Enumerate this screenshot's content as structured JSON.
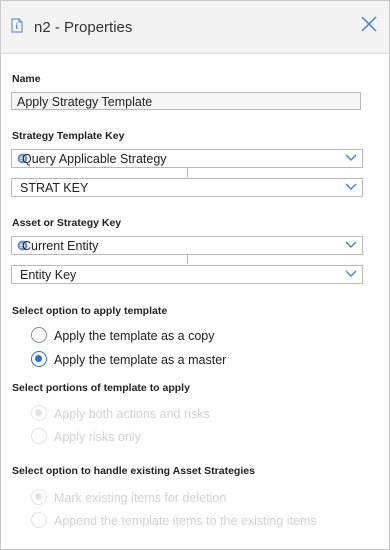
{
  "header": {
    "title": "n2 - Properties",
    "doc_icon": "document-icon",
    "close_icon": "close-icon"
  },
  "name_section": {
    "label": "Name",
    "value": "Apply Strategy Template"
  },
  "strategy_template_key": {
    "label": "Strategy Template Key",
    "source_value": "Query Applicable Strategy",
    "key_value": "STRAT KEY"
  },
  "asset_key": {
    "label": "Asset or Strategy Key",
    "source_value": "Current Entity",
    "key_value": "Entity Key"
  },
  "apply_option": {
    "label": "Select option to apply template",
    "options": [
      {
        "label": "Apply the template as a copy",
        "selected": false
      },
      {
        "label": "Apply the template as a master",
        "selected": true
      }
    ]
  },
  "portions_option": {
    "label": "Select portions of template to apply",
    "disabled": true,
    "options": [
      {
        "label": "Apply both actions and risks",
        "selected": true
      },
      {
        "label": "Apply risks only",
        "selected": false
      }
    ]
  },
  "existing_option": {
    "label": "Select option to handle existing Asset Strategies",
    "disabled": true,
    "options": [
      {
        "label": "Mark existing items for deletion",
        "selected": true
      },
      {
        "label": "Append the template items to the existing items",
        "selected": false
      }
    ]
  },
  "colors": {
    "accent": "#2a6fd4",
    "icon": "#6c93d6",
    "disabled": "#d2d2d2"
  }
}
